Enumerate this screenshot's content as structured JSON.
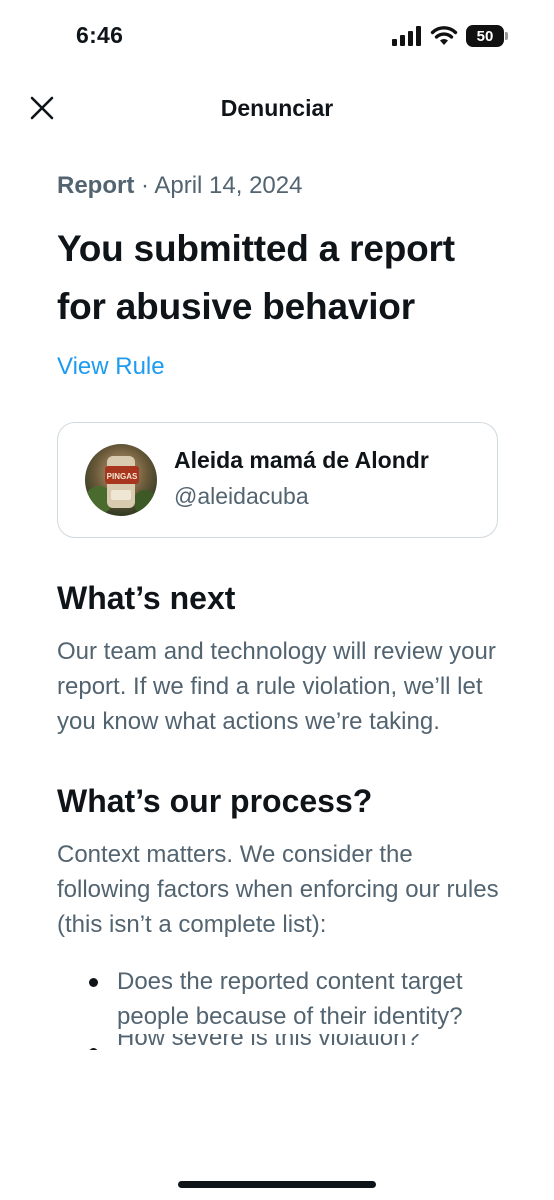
{
  "status_bar": {
    "time": "6:46",
    "battery_level": "50",
    "icons": [
      "cellular-signal-icon",
      "wifi-icon",
      "battery-icon"
    ]
  },
  "header": {
    "title": "Denunciar",
    "close_icon": "close-icon"
  },
  "report": {
    "type": "Report",
    "separator": " · ",
    "date": "April 14, 2024",
    "headline": "You submitted a report for abusive behavior",
    "view_rule_link": "View Rule"
  },
  "account": {
    "display_name": "Aleida mamá de Alondr",
    "handle": "@aleidacuba",
    "avatar_text": "PINGAS"
  },
  "whats_next": {
    "title": "What’s next",
    "body": "Our team and technology will review your report. If we find a rule violation, we’ll let you know what actions we’re taking."
  },
  "process": {
    "title": "What’s our process?",
    "body": "Context matters. We consider the following factors when enforcing our rules (this isn’t a complete list):",
    "bullets": [
      "Does the reported content target people because of their identity?",
      "How severe is this violation?"
    ]
  },
  "colors": {
    "text_primary": "#0f1419",
    "text_secondary": "#536471",
    "link": "#1d9bf0",
    "border": "#cfd9de"
  }
}
